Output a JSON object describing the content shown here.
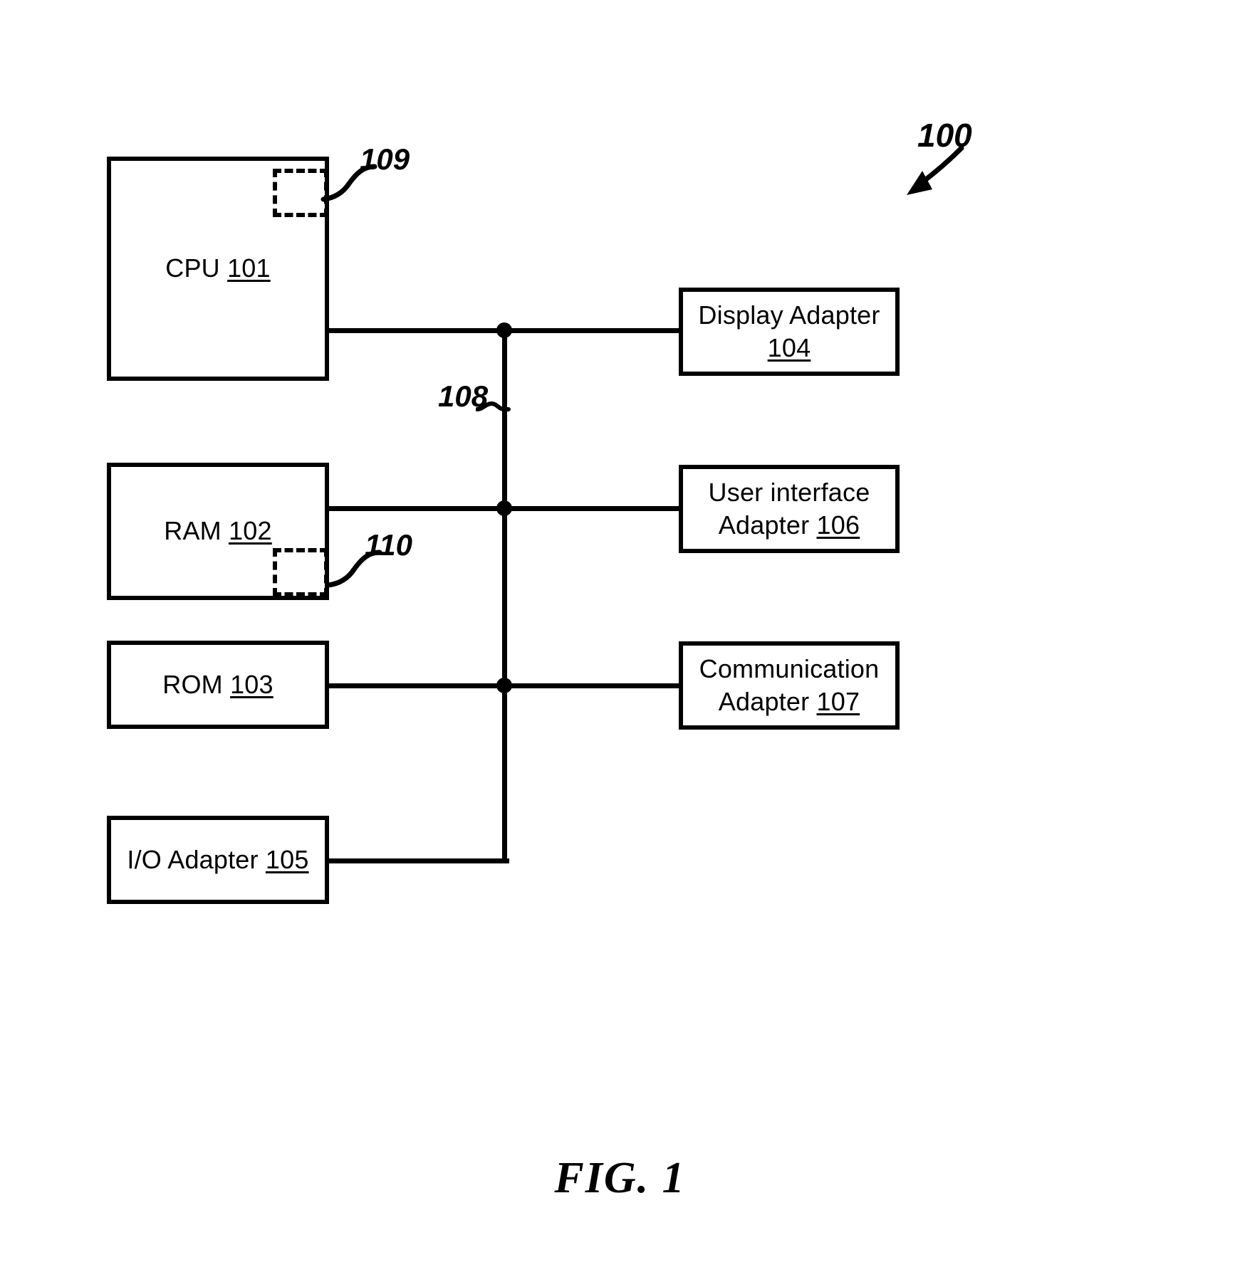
{
  "figure": {
    "caption": "FIG. 1",
    "system_ref": "100",
    "bus_ref": "108"
  },
  "blocks": {
    "cpu": {
      "name": "CPU",
      "ref": "101",
      "sub_ref": "109"
    },
    "ram": {
      "name": "RAM",
      "ref": "102",
      "sub_ref": "110"
    },
    "rom": {
      "name": "ROM",
      "ref": "103"
    },
    "io_adapter": {
      "name": "I/O Adapter",
      "ref": "105"
    },
    "display_adapter": {
      "name": "Display Adapter",
      "ref": "104"
    },
    "user_interface_adapter": {
      "name": "User interface\nAdapter",
      "ref": "106"
    },
    "communication_adapter": {
      "name": "Communication\nAdapter",
      "ref": "107"
    }
  },
  "colors": {
    "ink": "#000000",
    "paper": "#ffffff"
  }
}
